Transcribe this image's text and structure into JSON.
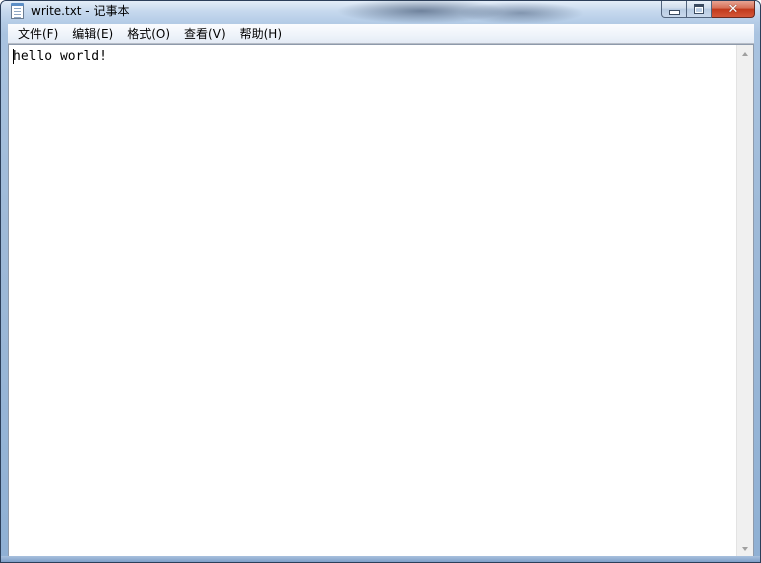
{
  "window": {
    "title": "write.txt - 记事本",
    "close_glyph": "✕"
  },
  "menu": {
    "items": [
      {
        "label": "文件(F)"
      },
      {
        "label": "编辑(E)"
      },
      {
        "label": "格式(O)"
      },
      {
        "label": "查看(V)"
      },
      {
        "label": "帮助(H)"
      }
    ]
  },
  "editor": {
    "content": "hello world!"
  },
  "icons": {
    "app": "notepad-icon",
    "minimize": "minimize-icon",
    "maximize": "maximize-icon",
    "close": "close-icon",
    "scroll_up": "scroll-up-arrow-icon",
    "scroll_down": "scroll-down-arrow-icon"
  }
}
